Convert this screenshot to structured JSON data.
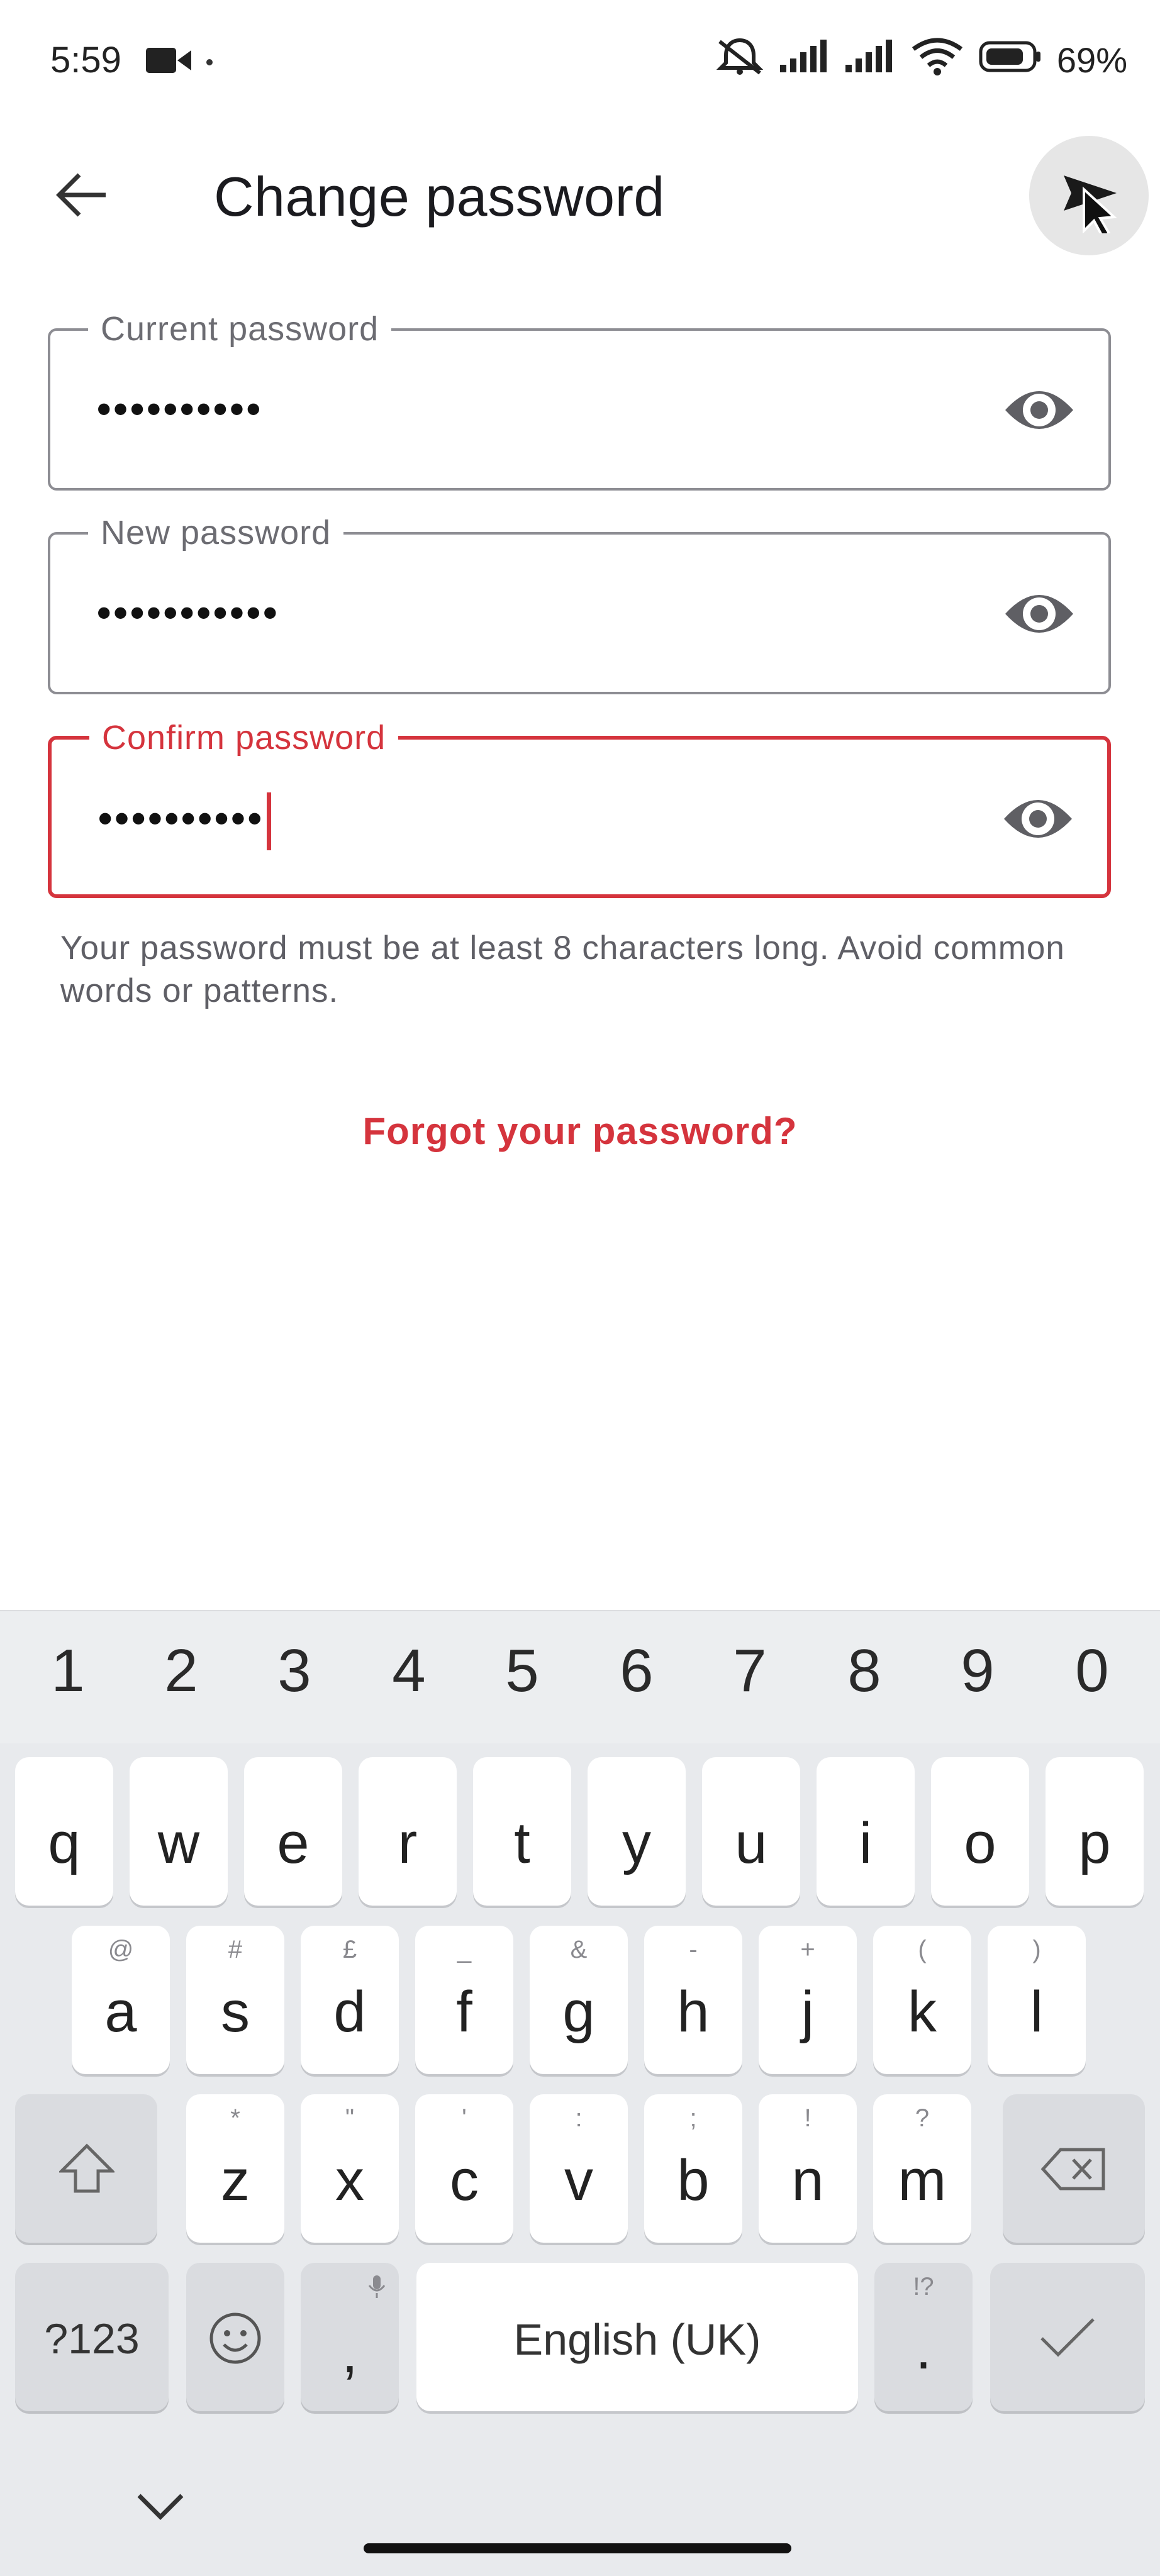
{
  "status_bar": {
    "time": "5:59",
    "battery": "69%"
  },
  "app_bar": {
    "title": "Change password"
  },
  "fields": [
    {
      "label": "Current password",
      "value": "••••••••••"
    },
    {
      "label": "New password",
      "value": "•••••••••••"
    },
    {
      "label": "Confirm password",
      "value": "••••••••••"
    }
  ],
  "helper_text": "Your password must be at least 8 characters long. Avoid common words or patterns.",
  "forgot_link": "Forgot your password?",
  "keyboard": {
    "numbers": [
      "1",
      "2",
      "3",
      "4",
      "5",
      "6",
      "7",
      "8",
      "9",
      "0"
    ],
    "row1": [
      "q",
      "w",
      "e",
      "r",
      "t",
      "y",
      "u",
      "i",
      "o",
      "p"
    ],
    "row2": [
      {
        "key": "a",
        "alt": "@"
      },
      {
        "key": "s",
        "alt": "#"
      },
      {
        "key": "d",
        "alt": "£"
      },
      {
        "key": "f",
        "alt": "_"
      },
      {
        "key": "g",
        "alt": "&"
      },
      {
        "key": "h",
        "alt": "-"
      },
      {
        "key": "j",
        "alt": "+"
      },
      {
        "key": "k",
        "alt": "("
      },
      {
        "key": "l",
        "alt": ")"
      }
    ],
    "row3": [
      {
        "key": "z",
        "alt": "*"
      },
      {
        "key": "x",
        "alt": "\""
      },
      {
        "key": "c",
        "alt": "'"
      },
      {
        "key": "v",
        "alt": ":"
      },
      {
        "key": "b",
        "alt": ";"
      },
      {
        "key": "n",
        "alt": "!"
      },
      {
        "key": "m",
        "alt": "?"
      }
    ],
    "symbols_label": "?123",
    "comma": ",",
    "space_label": "English (UK)",
    "period": ".",
    "period_alt": "!?"
  },
  "colors": {
    "accent_error": "#d5343d",
    "outline": "#8d8d93",
    "keyboard_bg": "#e8eaed"
  },
  "icons": {
    "back": "arrow-left-icon",
    "submit": "send-icon",
    "visibility": "eye-icon",
    "shift": "shift-icon",
    "backspace": "backspace-icon",
    "emoji": "emoji-icon",
    "mic": "mic-icon",
    "enter": "check-icon",
    "collapse": "chevron-down-icon"
  }
}
